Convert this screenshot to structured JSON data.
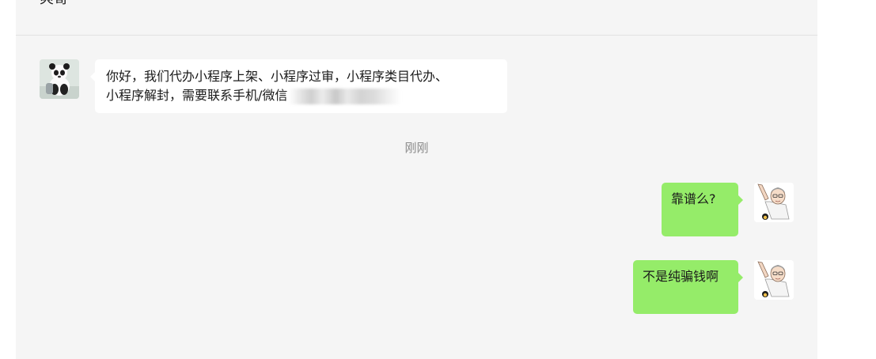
{
  "header": {
    "contact_name": "爽哥"
  },
  "messages": {
    "incoming": {
      "line1": "你好，我们代办小程序上架、小程序过审，小程序类目代办、",
      "line2": "小程序解封，需要联系手机/微信"
    },
    "timestamp": "刚刚",
    "outgoing_1": "靠谱么?",
    "outgoing_2": "不是纯骗钱啊"
  },
  "icons": {
    "incoming_avatar": "panda-avatar-icon",
    "outgoing_avatar": "cartoon-man-avatar-icon"
  },
  "colors": {
    "panel_background": "#f5f5f5",
    "incoming_bubble": "#ffffff",
    "outgoing_bubble": "#95ec69"
  }
}
